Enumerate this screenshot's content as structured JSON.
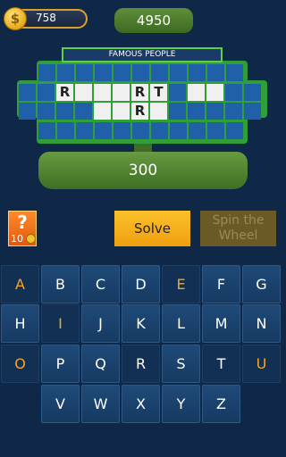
{
  "hud": {
    "coins": "758",
    "coin_symbol": "$",
    "score": "4950"
  },
  "board": {
    "category": "FAMOUS PEOPLE",
    "rows": [
      [
        "",
        "",
        "",
        "",
        "",
        "",
        "",
        "",
        "",
        "",
        ""
      ],
      [
        "",
        "",
        "R",
        "",
        "",
        "",
        "R",
        "T",
        "",
        "",
        "",
        "",
        ""
      ],
      [
        "",
        "",
        "",
        "",
        "",
        "",
        "R",
        "",
        "",
        "",
        "",
        "",
        ""
      ],
      [
        "",
        "",
        "",
        "",
        "",
        "",
        "",
        "",
        "",
        "",
        ""
      ]
    ]
  },
  "wheel_value": "300",
  "hint": {
    "symbol": "?",
    "cost": "10"
  },
  "actions": {
    "solve": "Solve",
    "spin": "Spin the Wheel"
  },
  "keyboard": {
    "rows": [
      [
        "A",
        "B",
        "C",
        "D",
        "E",
        "F",
        "G"
      ],
      [
        "H",
        "I",
        "J",
        "K",
        "L",
        "M",
        "N"
      ],
      [
        "O",
        "P",
        "Q",
        "R",
        "S",
        "T",
        "U"
      ],
      [
        "V",
        "W",
        "X",
        "Y",
        "Z"
      ]
    ]
  },
  "colors": {
    "vowel": "#f3a623",
    "frame": "#2f9f3a",
    "solve": "#fbc02a"
  }
}
